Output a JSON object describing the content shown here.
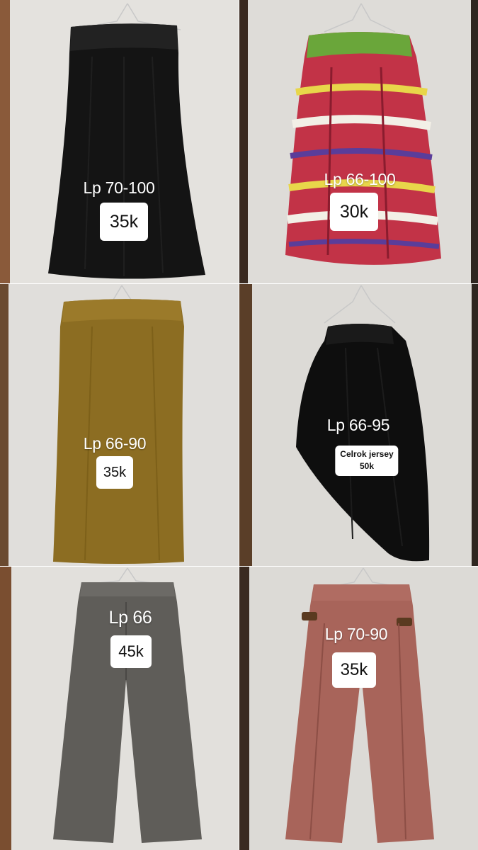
{
  "items": [
    {
      "size": "Lp 70-100",
      "price": "35k"
    },
    {
      "size": "Lp 66-100",
      "price": "30k"
    },
    {
      "size": "Lp 66-90",
      "price": "35k"
    },
    {
      "size": "Lp 66-95",
      "note": "Celrok jersey",
      "price": "50k"
    },
    {
      "size": "Lp 66",
      "price": "45k"
    },
    {
      "size": "Lp 70-90",
      "price": "35k"
    }
  ],
  "colors": {
    "wall": "#e2e0dc",
    "black_skirt": "#141414",
    "patterned_skirt": "#c23347",
    "mustard_skirt": "#8c6d22",
    "celrok_jersey": "#0e0e0e",
    "tweed_pants": "#5f5d59",
    "dusty_pink_pants": "#a8645a"
  }
}
